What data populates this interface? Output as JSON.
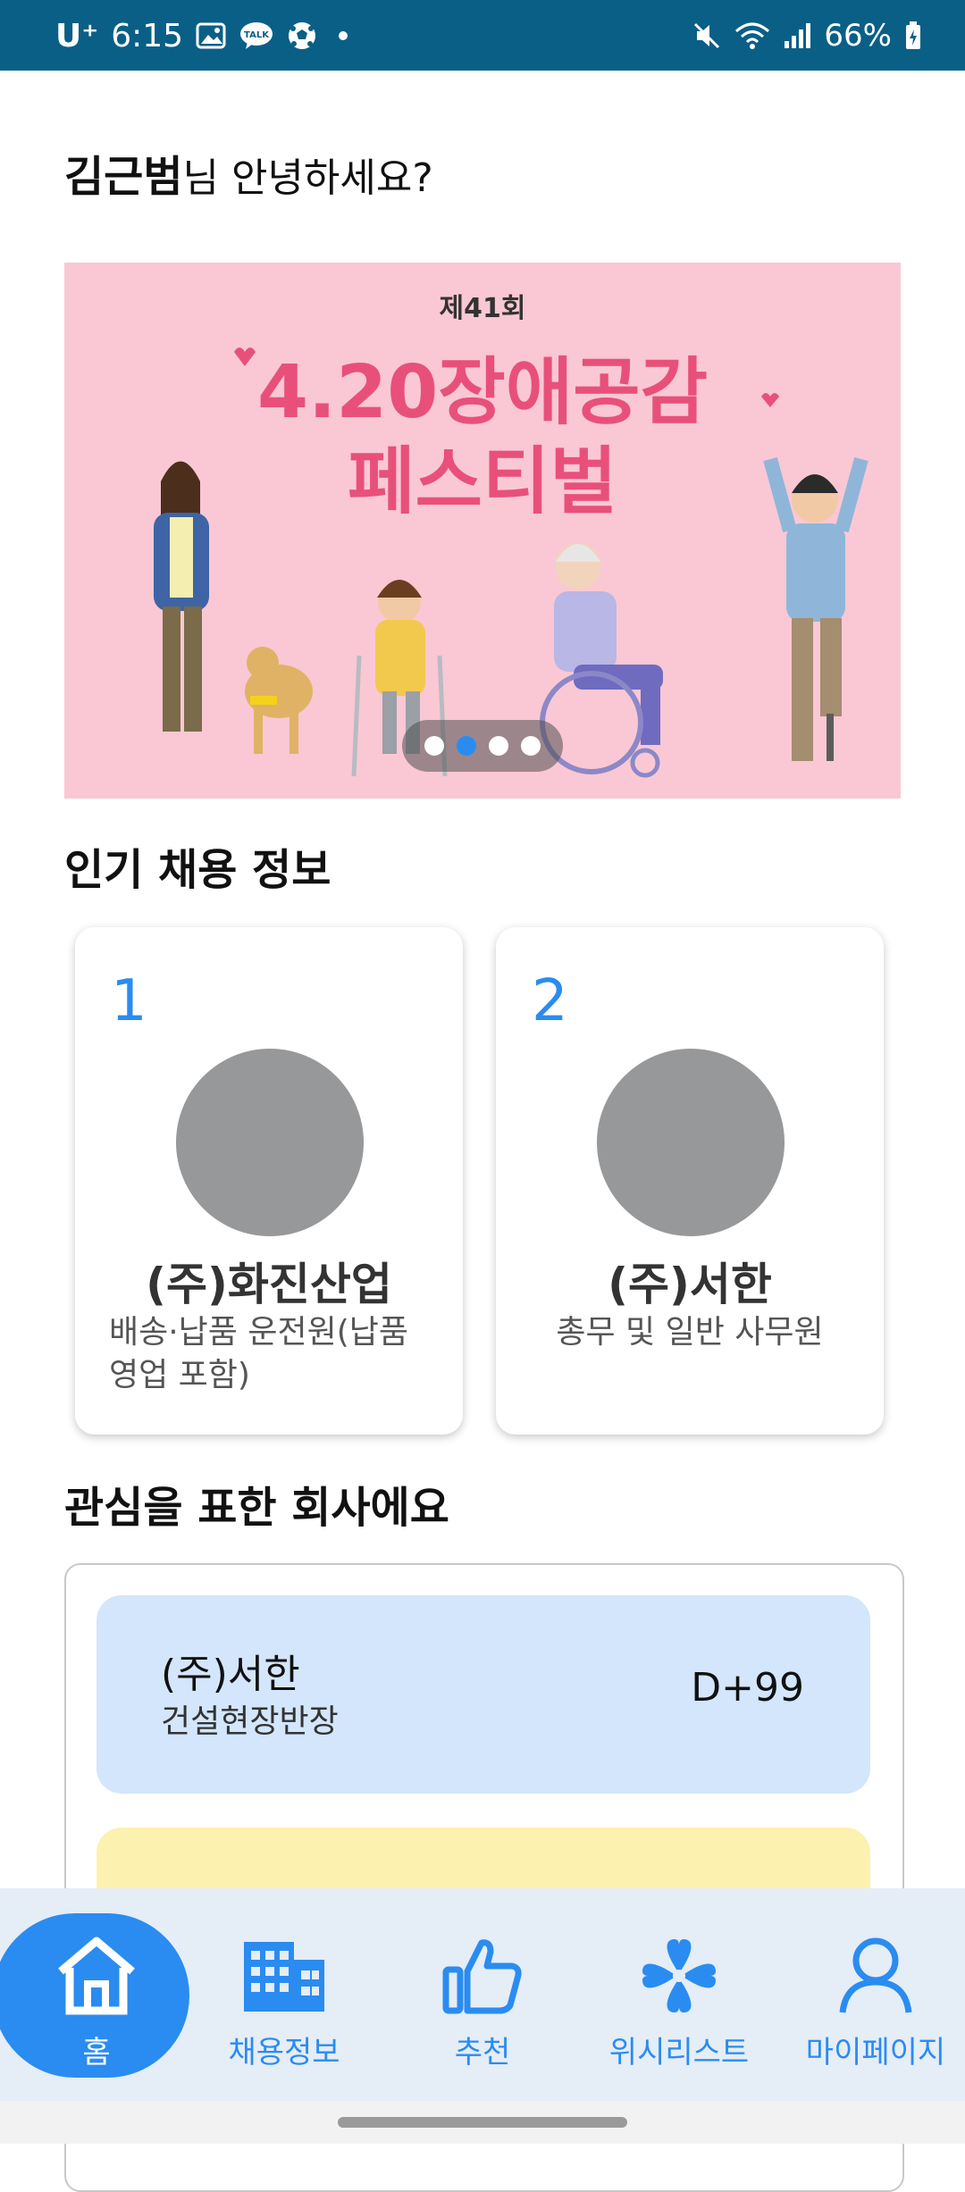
{
  "status_bar": {
    "carrier": "U⁺",
    "time": "6:15",
    "battery": "66%",
    "talk_badge": "TALK",
    "icons": [
      "gallery-icon",
      "kakaotalk-icon",
      "soccer-icon",
      "dot",
      "mute-icon",
      "wifi-icon",
      "signal-icon",
      "battery-icon"
    ]
  },
  "greeting": {
    "name": "김근범",
    "suffix": "님 안녕하세요?"
  },
  "banner": {
    "subtitle": "제41회",
    "title_line1": "4.20장애공감",
    "title_line2": "페스티벌",
    "slide_count": 4,
    "active_slide": 2
  },
  "popular_jobs": {
    "title": "인기 채용 정보",
    "items": [
      {
        "rank": "1",
        "company": "(주)화진산업",
        "role": "배송·납품 운전원(납품영업 포함)"
      },
      {
        "rank": "2",
        "company": "(주)서한",
        "role": "총무 및 일반 사무원"
      }
    ]
  },
  "interest": {
    "title": "관심을 표한 회사에요",
    "items": [
      {
        "company": "(주)서한",
        "position": "건설현장반장",
        "dday": "D+99",
        "color": "#d3e6fc"
      },
      {
        "company": "",
        "position": "",
        "dday": "",
        "color": "#fdf1b0"
      }
    ]
  },
  "bottom_nav": {
    "items": [
      {
        "label": "홈",
        "icon": "home-icon",
        "active": true
      },
      {
        "label": "채용정보",
        "icon": "building-icon",
        "active": false
      },
      {
        "label": "추천",
        "icon": "thumbs-up-icon",
        "active": false
      },
      {
        "label": "위시리스트",
        "icon": "clover-heart-icon",
        "active": false
      },
      {
        "label": "마이페이지",
        "icon": "person-icon",
        "active": false
      }
    ]
  },
  "colors": {
    "status_bar": "#0a5f86",
    "accent": "#2a8cf0",
    "banner_bg": "#f9c8d4",
    "banner_title": "#e8507a"
  }
}
